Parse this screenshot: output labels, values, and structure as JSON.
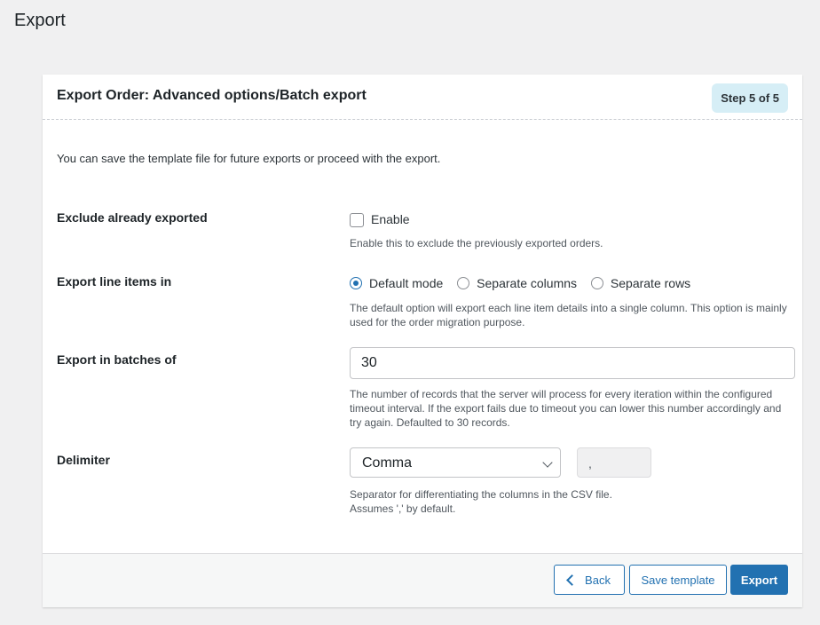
{
  "page": {
    "title": "Export"
  },
  "card": {
    "title": "Export Order: Advanced options/Batch export",
    "step": "Step 5 of 5",
    "intro": "You can save the template file for future exports or proceed with the export."
  },
  "fields": {
    "exclude": {
      "label": "Exclude already exported",
      "checkbox_label": "Enable",
      "checked": false,
      "description": "Enable this to exclude the previously exported orders."
    },
    "line_items": {
      "label": "Export line items in",
      "options": [
        "Default mode",
        "Separate columns",
        "Separate rows"
      ],
      "selected": "Default mode",
      "description": "The default option will export each line item details into a single column. This option is mainly used for the order migration purpose."
    },
    "batch": {
      "label": "Export in batches of",
      "value": "30",
      "description": "The number of records that the server will process for every iteration within the configured timeout interval. If the export fails due to timeout you can lower this number accordingly and try again. Defaulted to 30 records."
    },
    "delimiter": {
      "label": "Delimiter",
      "selected": "Comma",
      "value": ",",
      "description_line1": "Separator for differentiating the columns in the CSV file.",
      "description_line2": "Assumes ',' by default."
    }
  },
  "footer": {
    "back_label": "Back",
    "save_template_label": "Save template",
    "export_label": "Export"
  },
  "colors": {
    "accent": "#2271b1",
    "badge_bg": "#d6eef6",
    "background": "#f0f0f1"
  }
}
